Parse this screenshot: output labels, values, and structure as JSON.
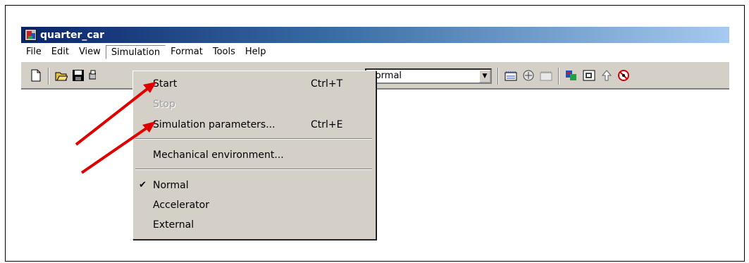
{
  "window": {
    "title": "quarter_car"
  },
  "menubar": {
    "items": [
      "File",
      "Edit",
      "View",
      "Simulation",
      "Format",
      "Tools",
      "Help"
    ]
  },
  "toolbar": {
    "mode_select_value": "Normal"
  },
  "simulation_menu": {
    "start_label": "Start",
    "start_shortcut": "Ctrl+T",
    "stop_label": "Stop",
    "params_label": "Simulation parameters...",
    "params_shortcut": "Ctrl+E",
    "mech_label": "Mechanical environment...",
    "normal_label": "Normal",
    "accelerator_label": "Accelerator",
    "external_label": "External"
  },
  "colors": {
    "arrow": "#e00000",
    "titlebar": "#0a246a",
    "menu_bg": "#d4d0c8"
  },
  "icons": [
    "new-document-icon",
    "open-folder-icon",
    "save-icon",
    "print-icon",
    "library-browser-icon",
    "model-browser-icon",
    "debug-icon",
    "build-icon",
    "subsystem-icon",
    "up-arrow-icon",
    "stop-sign-icon"
  ]
}
